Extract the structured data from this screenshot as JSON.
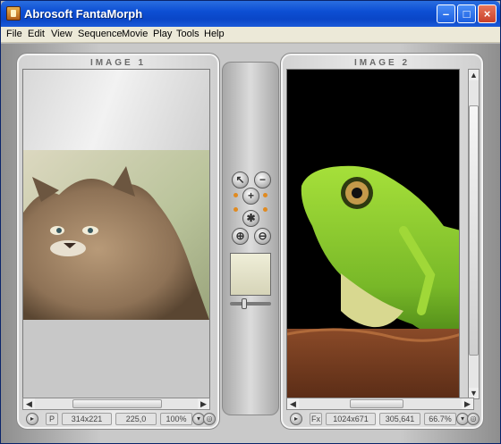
{
  "window": {
    "title": "Abrosoft FantaMorph"
  },
  "menu": [
    "File",
    "Edit",
    "View",
    "Sequence",
    "Movie",
    "Play",
    "Tools",
    "Help"
  ],
  "image1": {
    "label": "IMAGE 1",
    "mode": "P",
    "size": "314x221",
    "coords": "225,0",
    "zoom": "100%"
  },
  "image2": {
    "label": "IMAGE 2",
    "mode": "Fx",
    "size": "1024x671",
    "coords": "305,641",
    "zoom": "66.7%"
  },
  "colors": {
    "titlebar": "#0a46c7",
    "accent": "#e08a20"
  }
}
